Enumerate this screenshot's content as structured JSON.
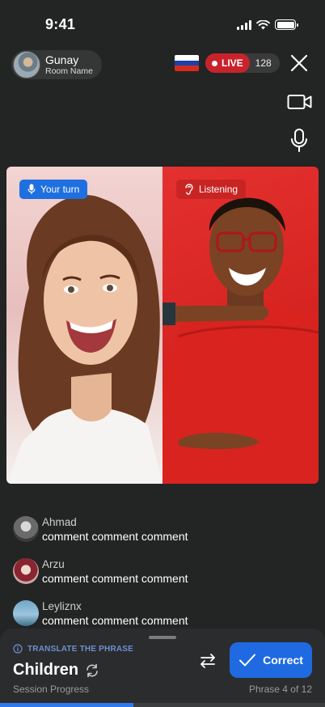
{
  "status_bar": {
    "time": "9:41"
  },
  "host": {
    "name": "Gunay",
    "room": "Room Name"
  },
  "live": {
    "label": "LIVE",
    "viewers": "128"
  },
  "video": {
    "left_badge": "Your turn",
    "right_badge": "Listening"
  },
  "icons": {
    "close": "close-icon",
    "camera": "video-camera-icon",
    "mic": "microphone-icon",
    "add_user": "add-user-icon",
    "game": "gamepad-icon",
    "collapse": "chevron-up-icon"
  },
  "comments": [
    {
      "name": "Ahmad",
      "text": "comment comment comment"
    },
    {
      "name": "Arzu",
      "text": "comment comment comment"
    },
    {
      "name": "Leyliznx",
      "text": "comment comment comment"
    }
  ],
  "sheet": {
    "label": "TRANSLATE THE PHRASE",
    "phrase": "Children",
    "progress_label": "Session Progress",
    "phrase_count": "Phrase 4 of 12",
    "progress": 0.41,
    "correct_label": "Correct"
  },
  "colors": {
    "background": "#232424",
    "accent": "#1f6ae0",
    "live": "#c8232b"
  }
}
